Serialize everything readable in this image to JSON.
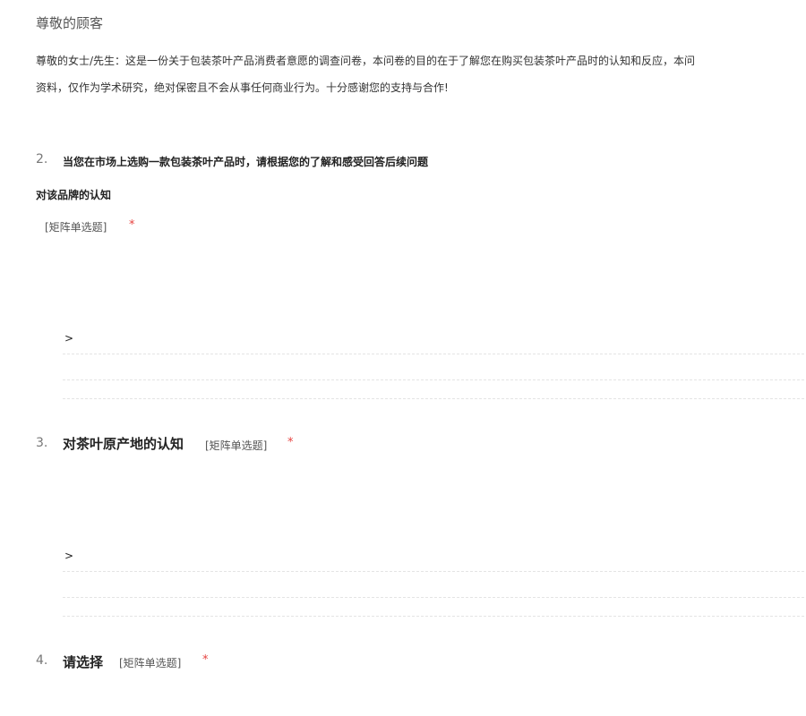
{
  "header": {
    "greeting": "尊敬的顾客"
  },
  "intro": {
    "line1": "尊敬的女士/先生：这是一份关于包装茶叶产品消费者意愿的调查问卷，本问卷的目的在于了解您在购买包装茶叶产品时的认知和反应，本问",
    "line2": "资料，仅作为学术研究，绝对保密且不会从事任何商业行为。十分感谢您的支持与合作!"
  },
  "questions": [
    {
      "number": "2.",
      "title": "当您在市场上选购一款包装茶叶产品时，请根据您的了解和感受回答后续问题",
      "subtitle": "对该品牌的认知",
      "type": "[矩阵单选题]",
      "required": "*",
      "expand": ">"
    },
    {
      "number": "3.",
      "title": "对茶叶原产地的认知",
      "type": "[矩阵单选题]",
      "required": "*",
      "expand": ">"
    },
    {
      "number": "4.",
      "title": "请选择",
      "type": "[矩阵单选题]",
      "required": "*"
    }
  ]
}
